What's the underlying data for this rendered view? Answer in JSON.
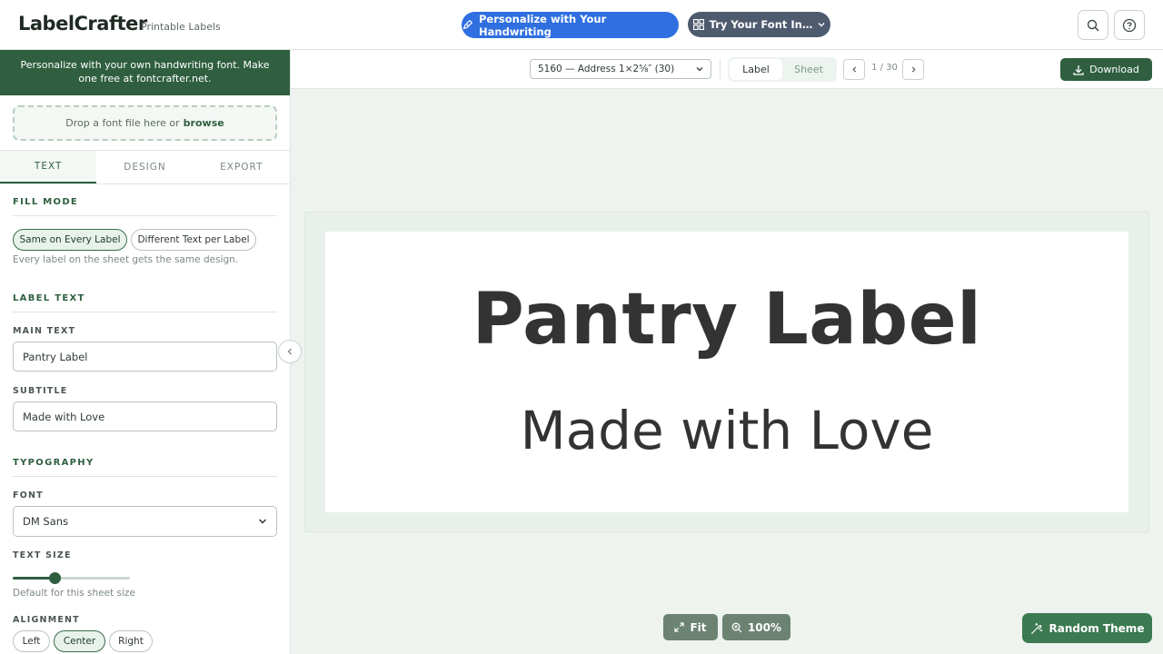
{
  "header": {
    "brand": "LabelCrafter",
    "brand_sub": "Printable Labels",
    "personalize_label": "Personalize with Your Handwriting",
    "try_font_label": "Try Your Font In…"
  },
  "sidebar": {
    "promo_text": "Personalize with your own handwriting font. Make one free at fontcrafter.net.",
    "dropzone_text": "Drop a font file here or",
    "dropzone_link": "browse",
    "tabs": [
      "TEXT",
      "DESIGN",
      "EXPORT"
    ],
    "active_tab": "TEXT",
    "fill_mode": {
      "title": "FILL MODE",
      "options": [
        "Same on Every Label",
        "Different Text per Label"
      ],
      "selected": "Same on Every Label",
      "hint": "Every label on the sheet gets the same design."
    },
    "label_text": {
      "title": "LABEL TEXT",
      "main_label": "MAIN TEXT",
      "main_value": "Pantry Label",
      "subtitle_label": "SUBTITLE",
      "subtitle_value": "Made with Love"
    },
    "typography": {
      "title": "TYPOGRAPHY",
      "font_label": "FONT",
      "font_value": "DM Sans",
      "size_label": "TEXT SIZE",
      "size_level": 0.36,
      "size_hint": "Default for this sheet size",
      "alignment_label": "ALIGNMENT",
      "alignment_options": [
        "Left",
        "Center",
        "Right"
      ],
      "alignment_selected": "Center"
    }
  },
  "toolbar": {
    "sheet_value": "5160 — Address 1×2⅝″ (30)",
    "view_options": [
      "Label",
      "Sheet"
    ],
    "view_selected": "Label",
    "page_text": "1 / 30",
    "download_label": "Download"
  },
  "canvas": {
    "main_text": "Pantry Label",
    "subtitle_text": "Made with Love"
  },
  "controls": {
    "fit_label": "Fit",
    "zoom_label": "100%",
    "random_label": "Random Theme"
  },
  "colors": {
    "accent": "#2f5f3f",
    "primary_blue": "#2f6fe0",
    "slate": "#4e5b6e",
    "random_green": "#3c7a51"
  }
}
